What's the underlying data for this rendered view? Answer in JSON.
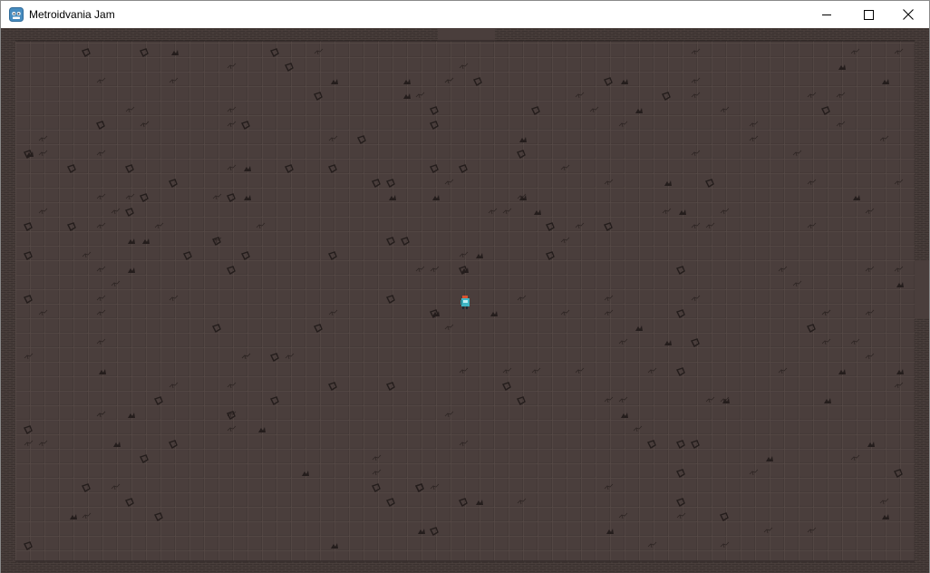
{
  "window": {
    "title": "Metroidvania Jam",
    "app_icon": "godot-engine-icon",
    "controls": {
      "minimize_icon": "minimize-icon",
      "maximize_icon": "maximize-icon",
      "close_icon": "close-icon"
    }
  },
  "game": {
    "scene": "dungeon-room",
    "floor_color": "#4a3e3c",
    "grid_line_color": "#5a4c49",
    "wall_color": "#2f2826",
    "decal_color": "#241d1c",
    "player": {
      "sprite": "player-character",
      "body_color": "#3fb6c4",
      "hair_color": "#d9532f"
    }
  }
}
